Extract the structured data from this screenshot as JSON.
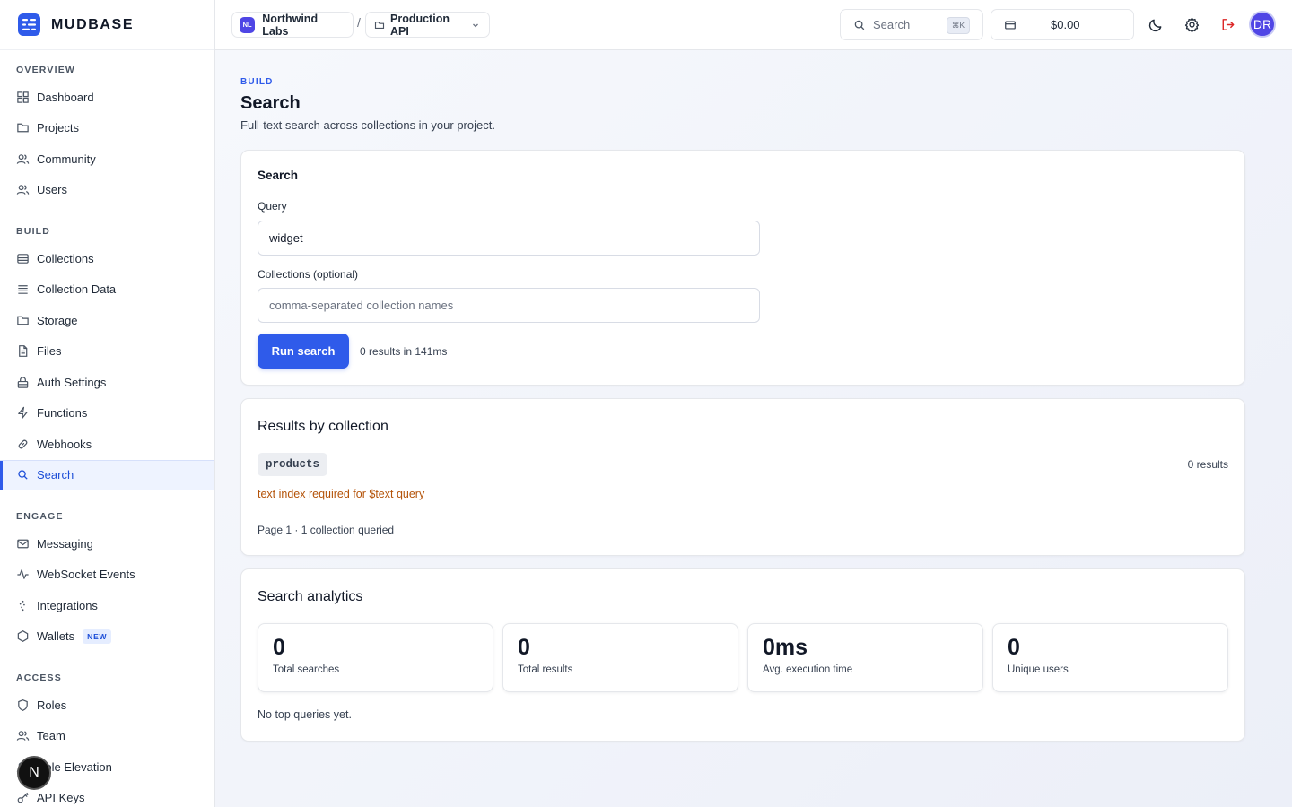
{
  "brand": {
    "name": "MUDBASE"
  },
  "sidebar": {
    "sections": [
      {
        "title": "OVERVIEW",
        "items": [
          {
            "label": "Dashboard",
            "icon": "grid-icon"
          },
          {
            "label": "Projects",
            "icon": "folder-icon"
          },
          {
            "label": "Community",
            "icon": "users-icon"
          },
          {
            "label": "Users",
            "icon": "users-icon"
          }
        ]
      },
      {
        "title": "BUILD",
        "items": [
          {
            "label": "Collections",
            "icon": "database-icon"
          },
          {
            "label": "Collection Data",
            "icon": "list-icon"
          },
          {
            "label": "Storage",
            "icon": "folder-icon"
          },
          {
            "label": "Files",
            "icon": "file-icon"
          },
          {
            "label": "Auth Settings",
            "icon": "lock-icon"
          },
          {
            "label": "Functions",
            "icon": "bolt-icon"
          },
          {
            "label": "Webhooks",
            "icon": "link-icon"
          },
          {
            "label": "Search",
            "icon": "search-icon",
            "active": true
          }
        ]
      },
      {
        "title": "ENGAGE",
        "items": [
          {
            "label": "Messaging",
            "icon": "mail-icon"
          },
          {
            "label": "WebSocket Events",
            "icon": "activity-icon"
          },
          {
            "label": "Integrations",
            "icon": "plug-icon"
          },
          {
            "label": "Wallets",
            "icon": "hexagon-icon",
            "badge": "NEW"
          }
        ]
      },
      {
        "title": "ACCESS",
        "items": [
          {
            "label": "Roles",
            "icon": "shield-icon"
          },
          {
            "label": "Team",
            "icon": "users-icon"
          },
          {
            "label": "Role Elevation",
            "icon": "user-plus-icon"
          },
          {
            "label": "API Keys",
            "icon": "key-icon"
          }
        ]
      }
    ],
    "floating_avatar": "N"
  },
  "topbar": {
    "org": {
      "badge": "NL",
      "name": "Northwind Labs"
    },
    "separator": "/",
    "project": {
      "name": "Production API"
    },
    "search": {
      "placeholder": "Search",
      "shortcut": "⌘K"
    },
    "credits": "$0.00",
    "avatar": "DR"
  },
  "page": {
    "eyebrow": "BUILD",
    "title": "Search",
    "subtitle": "Full-text search across collections in your project."
  },
  "search_form": {
    "title": "Search",
    "query_label": "Query",
    "query_value": "widget",
    "collections_label": "Collections (optional)",
    "collections_placeholder": "comma-separated collection names",
    "run_label": "Run search",
    "result_meta": "0 results in 141ms"
  },
  "results": {
    "title": "Results by collection",
    "collections": [
      {
        "name": "products",
        "count": "0 results",
        "warning": "text index required for $text query"
      }
    ],
    "pager": "Page 1 · 1 collection queried"
  },
  "analytics": {
    "title": "Search analytics",
    "stats": [
      {
        "value": "0",
        "label": "Total searches"
      },
      {
        "value": "0",
        "label": "Total results"
      },
      {
        "value": "0ms",
        "label": "Avg. execution time"
      },
      {
        "value": "0",
        "label": "Unique users"
      }
    ],
    "top_queries_empty": "No top queries yet."
  },
  "colors": {
    "accent": "#2f5bea",
    "warning": "#b45309",
    "avatar": "#5046e5"
  }
}
